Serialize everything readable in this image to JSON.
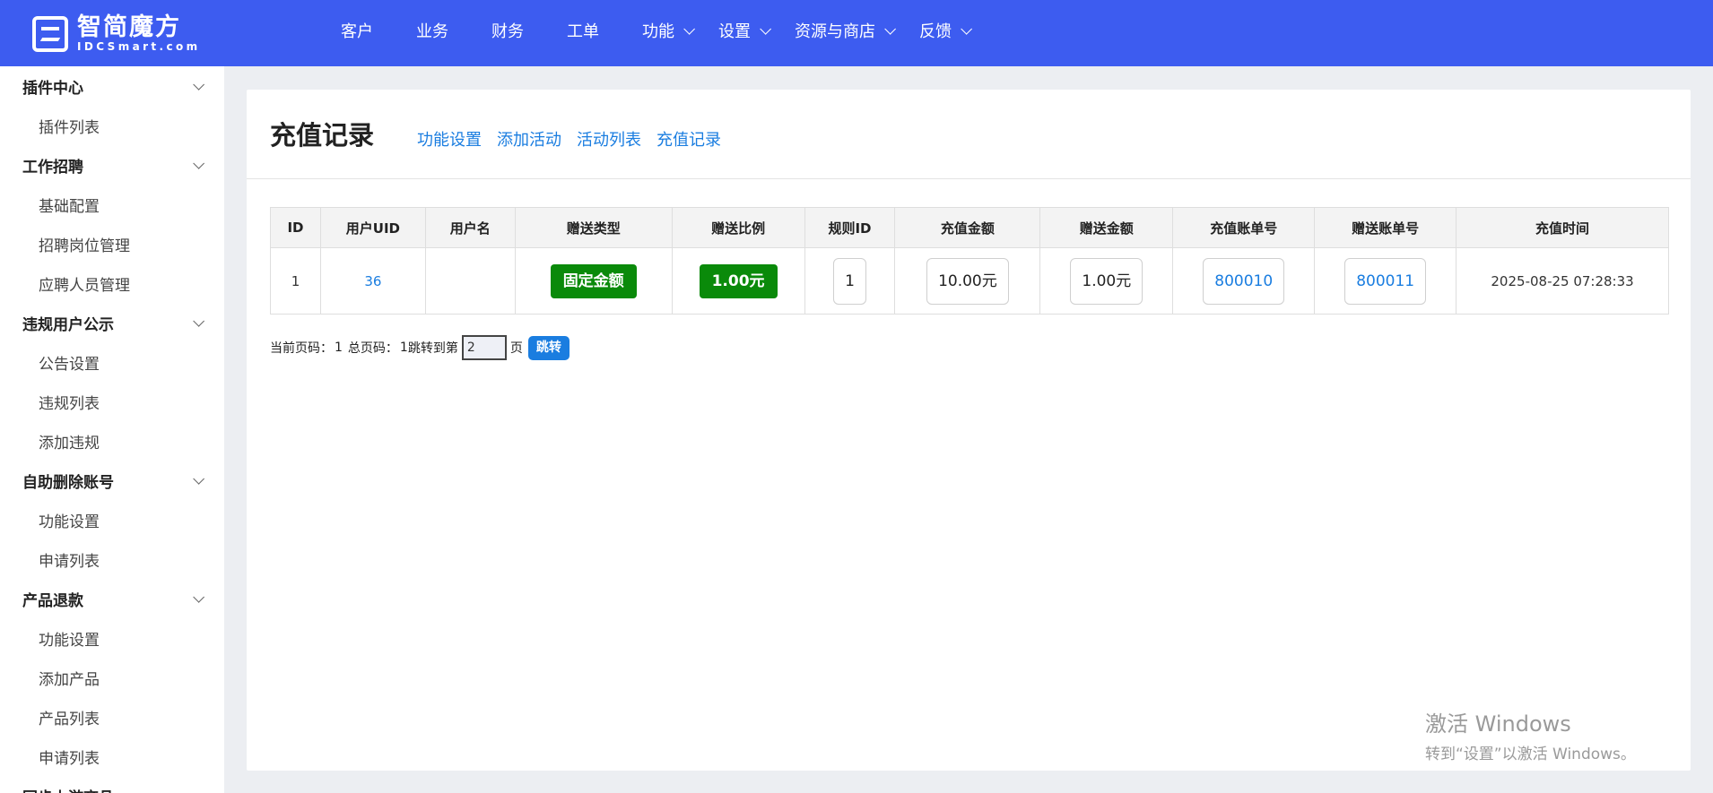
{
  "brand": {
    "title": "智简魔方",
    "subtitle": "IDCSmart.com"
  },
  "topnav": [
    {
      "label": "客户",
      "dropdown": false
    },
    {
      "label": "业务",
      "dropdown": false
    },
    {
      "label": "财务",
      "dropdown": false
    },
    {
      "label": "工单",
      "dropdown": false
    },
    {
      "label": "功能",
      "dropdown": true
    },
    {
      "label": "设置",
      "dropdown": true
    },
    {
      "label": "资源与商店",
      "dropdown": true
    },
    {
      "label": "反馈",
      "dropdown": true
    }
  ],
  "sidebar": {
    "groups": [
      {
        "label": "插件中心",
        "items": [
          "插件列表"
        ]
      },
      {
        "label": "工作招聘",
        "items": [
          "基础配置",
          "招聘岗位管理",
          "应聘人员管理"
        ]
      },
      {
        "label": "违规用户公示",
        "items": [
          "公告设置",
          "违规列表",
          "添加违规"
        ]
      },
      {
        "label": "自助删除账号",
        "items": [
          "功能设置",
          "申请列表"
        ]
      },
      {
        "label": "产品退款",
        "items": [
          "功能设置",
          "添加产品",
          "产品列表",
          "申请列表"
        ]
      },
      {
        "label": "同步上游商品",
        "items": []
      }
    ]
  },
  "page": {
    "title": "充值记录",
    "subnav": [
      "功能设置",
      "添加活动",
      "活动列表",
      "充值记录"
    ]
  },
  "table": {
    "headers": [
      "ID",
      "用户UID",
      "用户名",
      "赠送类型",
      "赠送比例",
      "规则ID",
      "充值金额",
      "赠送金额",
      "充值账单号",
      "赠送账单号",
      "充值时间"
    ],
    "rows": [
      {
        "id": "1",
        "uid": "36",
        "username": "",
        "gift_type": "固定金额",
        "gift_ratio": "1.00元",
        "rule_id": "1",
        "recharge_amount": "10.00元",
        "gift_amount": "1.00元",
        "recharge_invoice": "800010",
        "gift_invoice": "800011",
        "time": "2025-08-25 07:28:33"
      }
    ]
  },
  "pager": {
    "current_label": "当前页码：",
    "current": "1",
    "total_label": "总页码：",
    "total": "1",
    "jump_prefix": "跳转到第",
    "jump_value": "2",
    "jump_suffix": "页",
    "jump_button": "跳转"
  },
  "watermark": {
    "line1": "激活 Windows",
    "line2": "转到“设置”以激活 Windows。"
  },
  "colors": {
    "topbar": "#3d5cf0",
    "link": "#1a7de0",
    "badge_green": "#0a8a0a"
  }
}
